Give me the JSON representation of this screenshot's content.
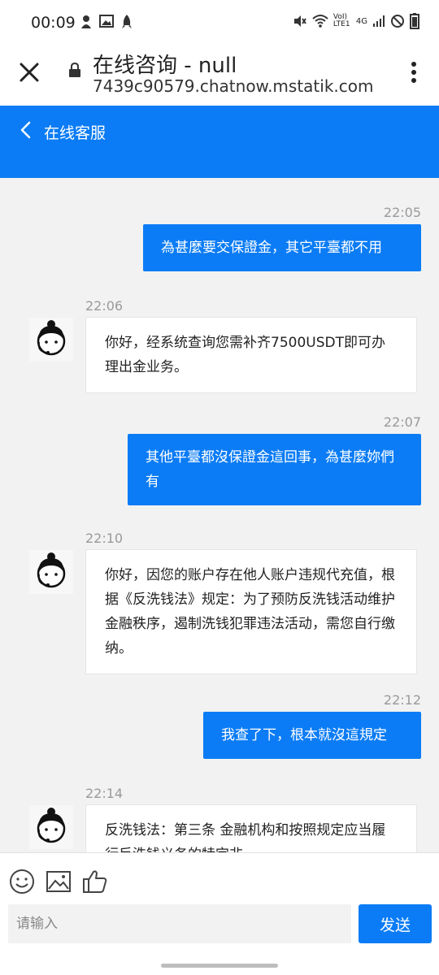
{
  "status_bar": {
    "time": "00:09",
    "left_icons": [
      "notification-icon",
      "image-icon",
      "rocket-icon"
    ],
    "right_icons": [
      "mute-icon",
      "wifi-icon",
      "volte-icon",
      "network-4g-icon",
      "signal-icon",
      "do-not-disturb-icon",
      "battery-icon"
    ],
    "volte_label": "VoI) LTE1",
    "net_label": "4G"
  },
  "browser": {
    "title": "在线咨询 - null",
    "url": "7439c90579.chatnow.mstatik.com"
  },
  "header": {
    "title": "在线客服"
  },
  "messages": [
    {
      "time": "22:05",
      "direction": "out",
      "text": "為甚麼要交保證金，其它平臺都不用"
    },
    {
      "time": "22:06",
      "direction": "in",
      "text": "你好，经系统查询您需补齐7500USDT即可办理出金业务。"
    },
    {
      "time": "22:07",
      "direction": "out",
      "text": "其他平臺都沒保證金這回事，為甚麼妳們有"
    },
    {
      "time": "22:10",
      "direction": "in",
      "text": "你好，因您的账户存在他人账户违规代充值，根据《反洗钱法》规定：为了预防反洗钱活动维护金融秩序，遏制洗钱犯罪违法活动，需您自行缴纳。"
    },
    {
      "time": "22:12",
      "direction": "out",
      "text": "我查了下，根本就沒這規定"
    },
    {
      "time": "22:14",
      "direction": "in",
      "text": "反洗钱法：第三条 金融机构和按照规定应当履行反洗钱义务的特定非"
    }
  ],
  "input": {
    "placeholder": "请输入",
    "send_label": "发送",
    "tools": [
      "emoji-icon",
      "image-icon",
      "thumbs-up-icon"
    ]
  },
  "colors": {
    "accent": "#0b7cf5",
    "background": "#f2f2f2"
  }
}
